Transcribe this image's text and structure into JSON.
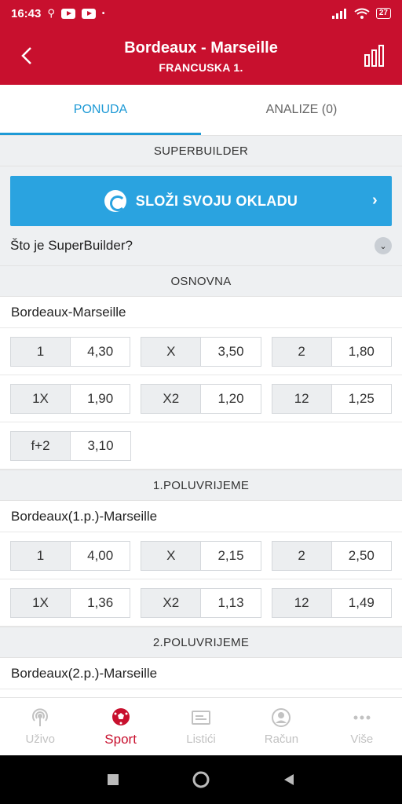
{
  "status_bar": {
    "time": "16:43",
    "battery": "27"
  },
  "header": {
    "title": "Bordeaux - Marseille",
    "subtitle": "FRANCUSKA 1."
  },
  "tabs": [
    {
      "label": "PONUDA",
      "active": true
    },
    {
      "label": "ANALIZE (0)",
      "active": false
    }
  ],
  "superbuilder": {
    "section": "SUPERBUILDER",
    "button_label": "SLOŽI SVOJU OKLADU",
    "info_label": "Što je SuperBuilder?"
  },
  "sections": [
    {
      "title": "OSNOVNA",
      "match": "Bordeaux-Marseille",
      "rows": [
        [
          {
            "label": "1",
            "value": "4,30"
          },
          {
            "label": "X",
            "value": "3,50"
          },
          {
            "label": "2",
            "value": "1,80"
          }
        ],
        [
          {
            "label": "1X",
            "value": "1,90"
          },
          {
            "label": "X2",
            "value": "1,20"
          },
          {
            "label": "12",
            "value": "1,25"
          }
        ],
        [
          {
            "label": "f+2",
            "value": "3,10"
          }
        ]
      ]
    },
    {
      "title": "1.POLUVRIJEME",
      "match": "Bordeaux(1.p.)-Marseille",
      "rows": [
        [
          {
            "label": "1",
            "value": "4,00"
          },
          {
            "label": "X",
            "value": "2,15"
          },
          {
            "label": "2",
            "value": "2,50"
          }
        ],
        [
          {
            "label": "1X",
            "value": "1,36"
          },
          {
            "label": "X2",
            "value": "1,13"
          },
          {
            "label": "12",
            "value": "1,49"
          }
        ]
      ]
    },
    {
      "title": "2.POLUVRIJEME",
      "match": "Bordeaux(2.p.)-Marseille",
      "rows": []
    }
  ],
  "bottom_nav": [
    {
      "label": "Uživo",
      "icon": "live-icon",
      "active": false
    },
    {
      "label": "Sport",
      "icon": "football-icon",
      "active": true
    },
    {
      "label": "Listići",
      "icon": "ticket-icon",
      "active": false
    },
    {
      "label": "Račun",
      "icon": "account-icon",
      "active": false
    },
    {
      "label": "Više",
      "icon": "more-icon",
      "active": false
    }
  ],
  "colors": {
    "brand_red": "#c8102e",
    "accent_blue": "#1e9ad6",
    "button_blue": "#2aa3e0"
  }
}
